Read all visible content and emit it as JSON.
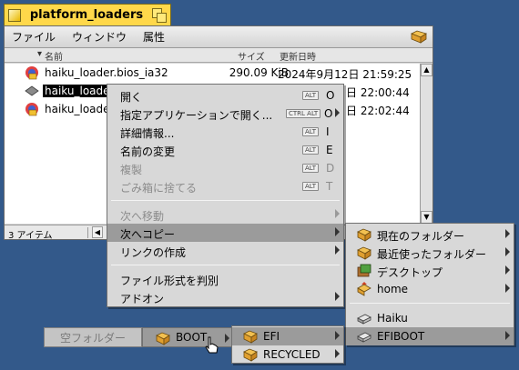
{
  "window": {
    "title": "platform_loaders",
    "menu": [
      "ファイル",
      "ウィンドウ",
      "属性"
    ],
    "columns": {
      "name": "名前",
      "size": "サイズ",
      "modified": "更新日時"
    },
    "files": [
      {
        "name": "haiku_loader.bios_ia32",
        "size": "290.09 KiB",
        "date": "2024年9月12日 21:59:25",
        "icon": "haiku-package-icon"
      },
      {
        "name": "haiku_loader",
        "size": "",
        "date": "日 22:00:44",
        "icon": "generic-file-icon",
        "selected": true
      },
      {
        "name": "haiku_loader",
        "size": "",
        "date": "日 22:02:44",
        "icon": "haiku-package-icon"
      }
    ],
    "status_count": "3 アイテム"
  },
  "context_menu": {
    "items": [
      {
        "label": "開く",
        "mod": "ALT",
        "key": "O"
      },
      {
        "label": "指定アプリケーションで開く...",
        "mod": "CTRL ALT",
        "key": "O",
        "submenu": true
      },
      {
        "label": "詳細情報...",
        "mod": "ALT",
        "key": "I"
      },
      {
        "label": "名前の変更",
        "mod": "ALT",
        "key": "E"
      },
      {
        "label": "複製",
        "mod": "ALT",
        "key": "D",
        "disabled": true
      },
      {
        "label": "ごみ箱に捨てる",
        "mod": "ALT",
        "key": "T",
        "disabled": true
      },
      {
        "label": "次へ移動",
        "disabled": true,
        "submenu": true
      },
      {
        "label": "次へコピー",
        "submenu": true,
        "highlighted": true
      },
      {
        "label": "リンクの作成",
        "submenu": true
      },
      {
        "label": "ファイル形式を判別"
      },
      {
        "label": "アドオン",
        "submenu": true
      }
    ]
  },
  "copy_submenu": {
    "items": [
      {
        "label": "現在のフォルダー",
        "icon": "folder-icon"
      },
      {
        "label": "最近使ったフォルダー",
        "icon": "folder-icon"
      },
      {
        "label": "デスクトップ",
        "icon": "desktop-icon"
      },
      {
        "label": "home",
        "icon": "home-folder-icon"
      },
      {
        "label": "Haiku",
        "icon": "disk-icon"
      },
      {
        "label": "EFIBOOT",
        "icon": "disk-icon",
        "highlighted": true
      }
    ]
  },
  "navigator": {
    "empty_folder": "空フォルダー",
    "boot": "BOOT",
    "efi": "EFI",
    "recycled": "RECYCLED"
  },
  "colors": {
    "desktop": "#33598a",
    "tab": "#ffd84a",
    "highlight": "#9b9b9b",
    "selection": "#000000"
  }
}
